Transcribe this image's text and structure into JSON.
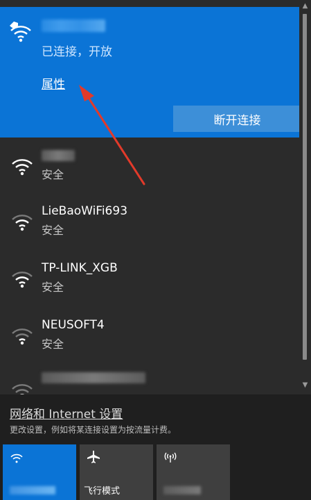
{
  "connected_network": {
    "status": "已连接，开放",
    "properties_label": "属性",
    "disconnect_label": "断开连接"
  },
  "networks": [
    {
      "security": "安全"
    },
    {
      "name": "LieBaoWiFi693",
      "security": "安全"
    },
    {
      "name": "TP-LINK_XGB",
      "security": "安全"
    },
    {
      "name": "NEUSOFT4",
      "security": "安全"
    }
  ],
  "footer": {
    "settings_label": "网络和 Internet 设置",
    "settings_desc": "更改设置，例如将某连接设置为按流量计费。"
  },
  "tiles": [
    {
      "icon": "wifi-icon"
    },
    {
      "label": "飞行模式",
      "icon": "airplane-icon"
    },
    {
      "icon": "hotspot-icon"
    }
  ],
  "colors": {
    "accent": "#0b74d6",
    "panel": "#2b2b2b",
    "annotation": "#e23a2a"
  }
}
